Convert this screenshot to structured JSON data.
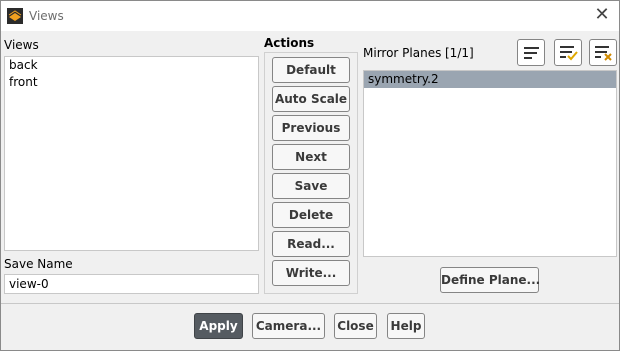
{
  "window": {
    "title": "Views"
  },
  "views_panel": {
    "label": "Views",
    "items": [
      {
        "label": "back"
      },
      {
        "label": "front"
      }
    ],
    "save_name_label": "Save Name",
    "save_name_value": "view-0"
  },
  "actions_panel": {
    "label": "Actions",
    "buttons": [
      {
        "label": "Default"
      },
      {
        "label": "Auto Scale"
      },
      {
        "label": "Previous"
      },
      {
        "label": "Next"
      },
      {
        "label": "Save"
      },
      {
        "label": "Delete"
      },
      {
        "label": "Read..."
      },
      {
        "label": "Write..."
      }
    ]
  },
  "mirror_planes": {
    "label": "Mirror Planes",
    "count": "[1/1]",
    "items": [
      {
        "label": "symmetry.2",
        "selected": true
      }
    ],
    "define_plane_label": "Define Plane...",
    "icons": [
      "list-icon",
      "select-all-icon",
      "deselect-all-icon"
    ]
  },
  "footer": {
    "apply_label": "Apply",
    "camera_label": "Camera...",
    "close_label": "Close",
    "help_label": "Help"
  },
  "colors": {
    "primary_button": "#555b61",
    "selection": "#9aa5b1",
    "check_accent": "#e0a800",
    "cross_accent": "#d08a00"
  }
}
